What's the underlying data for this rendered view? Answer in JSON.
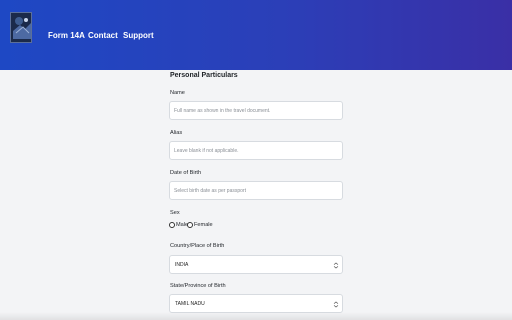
{
  "nav": {
    "links": [
      "Form 14A",
      "Contact",
      "Support"
    ]
  },
  "form": {
    "section_title": "Personal Particulars",
    "name": {
      "label": "Name",
      "placeholder": "Full name as shown in the travel document."
    },
    "alias": {
      "label": "Alias",
      "placeholder": "Leave blank if not applicable."
    },
    "dob": {
      "label": "Date of Birth",
      "placeholder": "Select birth date as per passport"
    },
    "sex": {
      "label": "Sex",
      "options": [
        "Male",
        "Female"
      ]
    },
    "country": {
      "label": "Country/Place of Birth",
      "value": "INDIA"
    },
    "state": {
      "label": "State/Province of Birth",
      "value": "TAMIL NADU"
    }
  },
  "colors": {
    "header_start": "#1e48c4",
    "header_end": "#3a2fa6"
  }
}
